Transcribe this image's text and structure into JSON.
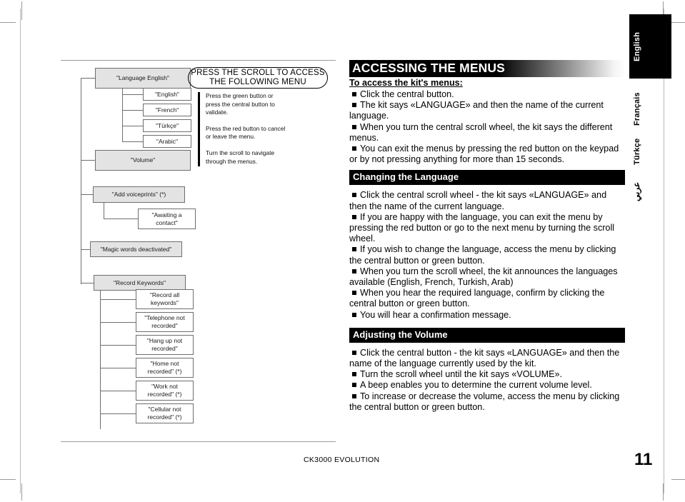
{
  "page": {
    "footer_title": "CK3000 EVOLUTION",
    "page_number": "11"
  },
  "language_tabs": [
    {
      "id": "english",
      "label": "English",
      "active": true
    },
    {
      "id": "francais",
      "label": "Français",
      "active": false
    },
    {
      "id": "turkce",
      "label": "Türkçe",
      "active": false
    },
    {
      "id": "arabic",
      "label": "عربي",
      "active": false
    }
  ],
  "callout": {
    "title": "PRESS THE SCROLL TO ACCESS THE FOLLOWING MENU",
    "paragraphs": [
      "Press the green button or press the central button to validate.",
      "Press the red button to cancel or leave the menu.",
      "Turn the scroll to navigate through the menus."
    ]
  },
  "diagram": {
    "nodes": [
      {
        "id": "language-english",
        "label": "\"Language English\"",
        "level": 1
      },
      {
        "id": "english",
        "label": "\"English\"",
        "level": 2
      },
      {
        "id": "french",
        "label": "\"French\"",
        "level": 2
      },
      {
        "id": "turkce",
        "label": "\"Türkçe\"",
        "level": 2
      },
      {
        "id": "arabic",
        "label": "\"Arabic\"",
        "level": 2
      },
      {
        "id": "volume",
        "label": "\"Volume\"",
        "level": 1
      },
      {
        "id": "add-voiceprints",
        "label": "\"Add voiceprints\" (*)",
        "level": 1
      },
      {
        "id": "awaiting-a-contact",
        "label": "\"Awaiting a contact\"",
        "level": 2
      },
      {
        "id": "magic-words-deactivated",
        "label": "\"Magic words deactivated\"",
        "level": 1
      },
      {
        "id": "record-keywords",
        "label": "\"Record Keywords\"",
        "level": 1
      },
      {
        "id": "record-all-keywords",
        "label": "\"Record all keywords\"",
        "level": 2
      },
      {
        "id": "telephone-not-recorded",
        "label": "\"Telephone not recorded\"",
        "level": 2
      },
      {
        "id": "hang-up-not-recorded",
        "label": "\"Hang up not recorded\"",
        "level": 2
      },
      {
        "id": "home-not-recorded",
        "label": "\"Home not recorded\" (*)",
        "level": 2
      },
      {
        "id": "work-not-recorded",
        "label": "\"Work not recorded\" (*)",
        "level": 2
      },
      {
        "id": "cellular-not-recorded",
        "label": "\"Cellular not recorded\" (*)",
        "level": 2
      }
    ]
  },
  "content": {
    "main_heading": "ACCESSING THE MENUS",
    "sub_heading": "To access the kit's menus:",
    "intro_bullets": [
      "Click the central button.",
      "The kit says «LANGUAGE» and then the name of the current language.",
      "When you turn the central scroll wheel, the kit says the different menus.",
      "You can exit the menus by pressing the red button on the keypad or by not pressing anything for more than 15 seconds."
    ],
    "section_language_title": "Changing the Language",
    "section_language_bullets": [
      "Click the central scroll wheel - the kit says «LANGUAGE» and then the name of the current language.",
      "If you are happy with the language, you can exit the menu by pressing the red button or go to the next menu by turning the scroll wheel.",
      "If you wish to change the language, access the menu by clicking the central button or green button.",
      "When you turn the scroll wheel, the kit announces the languages available (English, French, Turkish, Arab)",
      "When you hear the required language, confirm by clicking the central button or green button.",
      "You will hear a confirmation message."
    ],
    "section_volume_title": "Adjusting the Volume",
    "section_volume_bullets": [
      "Click the central button - the kit says «LANGUAGE» and then the name of the language currently used by the kit.",
      "Turn the scroll wheel until the kit says «VOLUME».",
      "A beep enables you to determine the current volume level.",
      "To increase or decrease the volume, access the menu by clicking the central button or green button."
    ]
  },
  "colors": {
    "node_fill_level1": "#e3e3e3",
    "node_fill_level2": "#ffffff",
    "node_border": "#6e6e6e",
    "bar_background": "#000000",
    "bar_text": "#ffffff"
  }
}
